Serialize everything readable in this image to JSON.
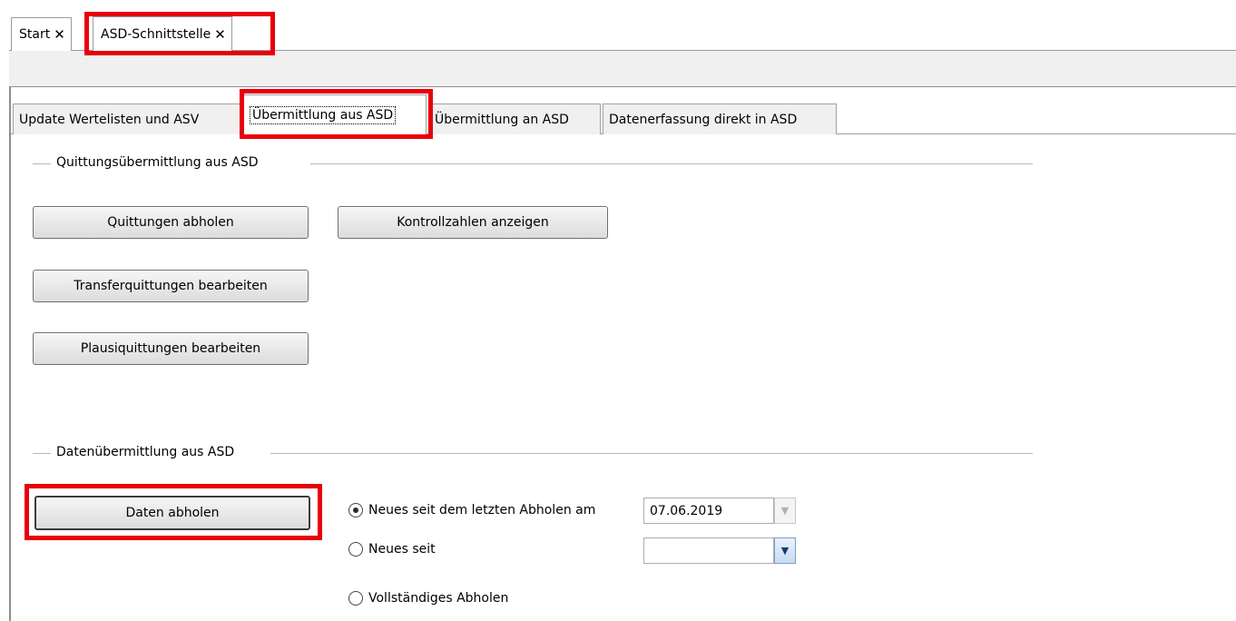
{
  "doc_tabs": [
    {
      "label": "Start",
      "close": "✕"
    },
    {
      "label": "ASD-Schnittstelle",
      "close": "✕"
    }
  ],
  "inner_tabs": [
    {
      "label": "Update Wertelisten und ASV"
    },
    {
      "label": "Übermittlung aus ASD"
    },
    {
      "label": "Übermittlung an ASD"
    },
    {
      "label": "Datenerfassung direkt in ASD"
    }
  ],
  "group1": {
    "title": "Quittungsübermittlung aus ASD",
    "buttons": {
      "quittungen_abholen": "Quittungen abholen",
      "kontrollzahlen_anzeigen": "Kontrollzahlen anzeigen",
      "transferquittungen_bearbeiten": "Transferquittungen bearbeiten",
      "plausiquittungen_bearbeiten": "Plausiquittungen bearbeiten"
    }
  },
  "group2": {
    "title": "Datenübermittlung aus ASD",
    "daten_abholen": "Daten abholen",
    "options": [
      {
        "label": "Neues seit dem letzten Abholen am",
        "selected": true
      },
      {
        "label": "Neues seit",
        "selected": false
      },
      {
        "label": "Vollständiges Abholen",
        "selected": false
      }
    ],
    "last_date": "07.06.2019",
    "since_date": ""
  },
  "icons": {
    "dropdown": "▼"
  },
  "colors": {
    "highlight": "#e8000b"
  }
}
